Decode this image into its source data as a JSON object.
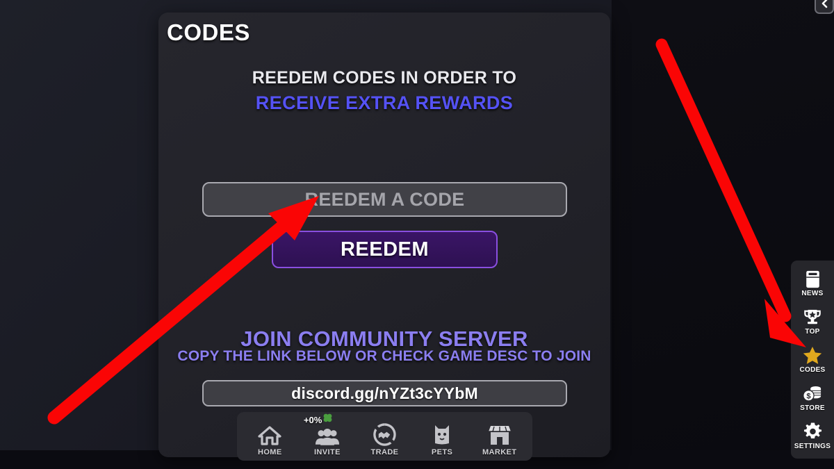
{
  "panel": {
    "title": "CODES",
    "subtitle_line1": "REEDEM CODES IN ORDER TO",
    "subtitle_line2": "RECEIVE EXTRA REWARDS",
    "code_input_placeholder": "REEDEM A CODE",
    "code_input_value": "",
    "redeem_button_label": "REEDEM",
    "community_heading": "JOIN COMMUNITY SERVER",
    "community_subtext": "COPY THE LINK BELOW OR CHECK GAME DESC TO JOIN",
    "discord_link": "discord.gg/nYZt3cYYbM"
  },
  "bottom_nav": {
    "items": [
      {
        "label": "HOME",
        "icon": "home-icon"
      },
      {
        "label": "INVITE",
        "icon": "people-icon",
        "badge": "+0%",
        "badge_icon": "clover-icon"
      },
      {
        "label": "TRADE",
        "icon": "handshake-icon"
      },
      {
        "label": "PETS",
        "icon": "pet-icon"
      },
      {
        "label": "MARKET",
        "icon": "market-stall-icon"
      }
    ]
  },
  "sidebar": {
    "items": [
      {
        "label": "NEWS",
        "icon": "book-icon",
        "active": false
      },
      {
        "label": "TOP",
        "icon": "trophy-icon",
        "active": false
      },
      {
        "label": "CODES",
        "icon": "star-icon",
        "active": true
      },
      {
        "label": "STORE",
        "icon": "coins-icon",
        "active": false
      },
      {
        "label": "SETTINGS",
        "icon": "gear-icon",
        "active": false
      }
    ]
  },
  "collapse_button": {
    "icon": "chevron-left-icon"
  },
  "colors": {
    "accent_blue": "#5552f5",
    "accent_purple": "#8b7ef0",
    "redeem_purple": "#3a1566",
    "star_gold": "#e0a81e",
    "clover_green": "#4a9e3f",
    "annotation_red": "#fa0505"
  },
  "annotations": {
    "arrow_1_target": "code-input",
    "arrow_2_target": "sidebar-item-codes"
  }
}
